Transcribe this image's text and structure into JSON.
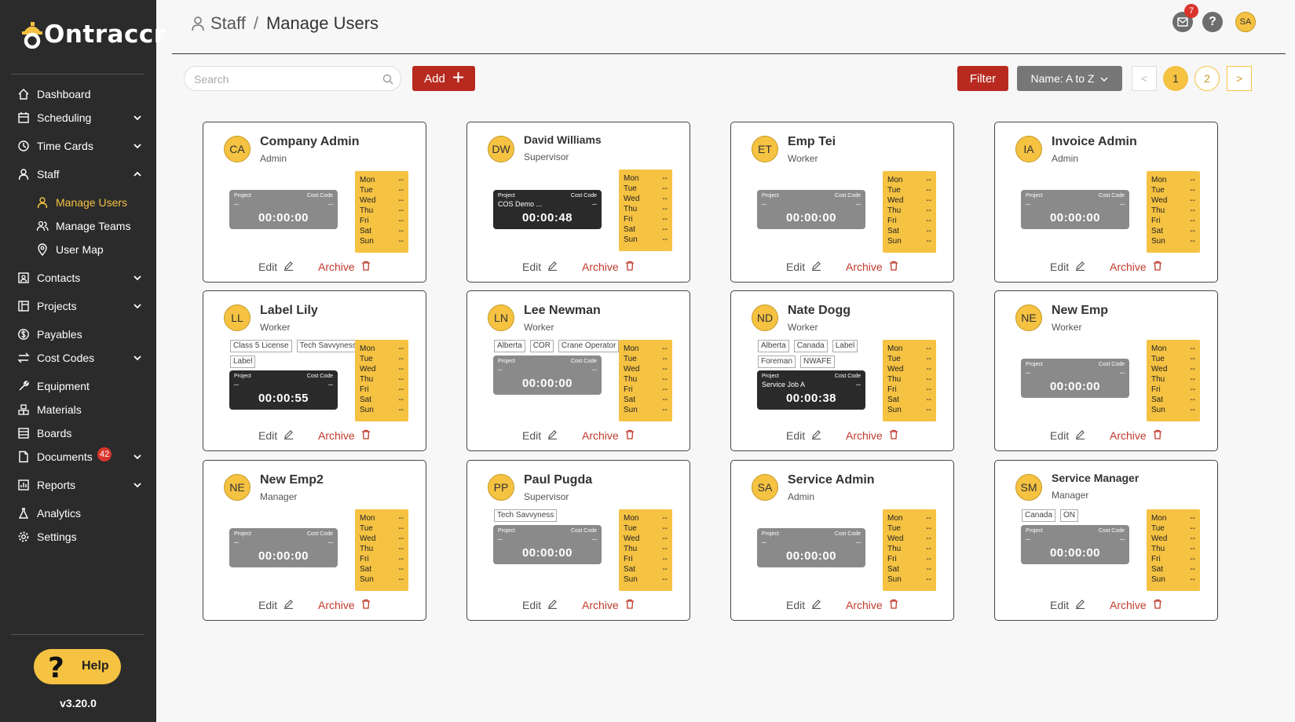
{
  "app": {
    "name": "Ontraccr",
    "version": "v3.20.0",
    "help_label": "Help"
  },
  "colors": {
    "accent": "#f5c242",
    "primary_action": "#b82a1f",
    "sidebar": "#2b2b2b"
  },
  "sidebar": {
    "items": [
      {
        "label": "Dashboard",
        "icon": "home-icon"
      },
      {
        "label": "Scheduling",
        "icon": "calendar-icon",
        "expandable": true
      },
      {
        "label": "Time Cards",
        "icon": "clock-icon",
        "expandable": true
      },
      {
        "label": "Staff",
        "icon": "person-icon",
        "expandable": true,
        "expanded": true
      },
      {
        "label": "Manage Users",
        "icon": "person-icon",
        "sub": true,
        "active": true
      },
      {
        "label": "Manage Teams",
        "icon": "team-icon",
        "sub": true
      },
      {
        "label": "User Map",
        "icon": "map-pin-icon",
        "sub": true
      },
      {
        "label": "Contacts",
        "icon": "contacts-icon",
        "expandable": true
      },
      {
        "label": "Projects",
        "icon": "projects-icon",
        "expandable": true
      },
      {
        "label": "Payables",
        "icon": "dollar-icon"
      },
      {
        "label": "Cost Codes",
        "icon": "swap-icon",
        "expandable": true
      },
      {
        "label": "Equipment",
        "icon": "wrench-icon"
      },
      {
        "label": "Materials",
        "icon": "materials-icon"
      },
      {
        "label": "Boards",
        "icon": "board-icon"
      },
      {
        "label": "Documents",
        "icon": "document-icon",
        "expandable": true,
        "badge": "42"
      },
      {
        "label": "Reports",
        "icon": "report-icon",
        "expandable": true
      },
      {
        "label": "Analytics",
        "icon": "flask-icon"
      },
      {
        "label": "Settings",
        "icon": "gear-icon"
      }
    ]
  },
  "header": {
    "breadcrumb_parent": "Staff",
    "breadcrumb_separator": "/",
    "breadcrumb_current": "Manage Users",
    "mail_badge": "7",
    "help_glyph": "?",
    "user_initials": "SA"
  },
  "toolbar": {
    "search_placeholder": "Search",
    "add_label": "Add",
    "filter_label": "Filter",
    "sort_label": "Name: A to Z",
    "pagination": {
      "prev": "<",
      "pages": [
        "1",
        "2"
      ],
      "current": "1",
      "next": ">"
    }
  },
  "labels": {
    "project": "Project",
    "cost_code": "Cost Code",
    "edit": "Edit",
    "archive": "Archive",
    "days": [
      "Mon",
      "Tue",
      "Wed",
      "Thu",
      "Fri",
      "Sat",
      "Sun"
    ],
    "day_value": "--"
  },
  "users": [
    {
      "initials": "CA",
      "name": "Company Admin",
      "role": "Admin",
      "tags": [],
      "project": "--",
      "cost_code": "--",
      "time": "00:00:00",
      "running": false
    },
    {
      "initials": "DW",
      "name": "David Williams",
      "role": "Supervisor",
      "tags": [],
      "project": "COS Demo ...",
      "cost_code": "--",
      "time": "00:00:48",
      "running": true
    },
    {
      "initials": "ET",
      "name": "Emp Tei",
      "role": "Worker",
      "tags": [],
      "project": "--",
      "cost_code": "--",
      "time": "00:00:00",
      "running": false
    },
    {
      "initials": "IA",
      "name": "Invoice Admin",
      "role": "Admin",
      "tags": [],
      "project": "--",
      "cost_code": "--",
      "time": "00:00:00",
      "running": false
    },
    {
      "initials": "LL",
      "name": "Label Lily",
      "role": "Worker",
      "tags": [
        "Class 5 License",
        "Tech Savvyness",
        "Label"
      ],
      "project": "--",
      "cost_code": "--",
      "time": "00:00:55",
      "running": true
    },
    {
      "initials": "LN",
      "name": "Lee Newman",
      "role": "Worker",
      "tags": [
        "Alberta",
        "COR",
        "Crane Operator"
      ],
      "project": "--",
      "cost_code": "--",
      "time": "00:00:00",
      "running": false
    },
    {
      "initials": "ND",
      "name": "Nate Dogg",
      "role": "Worker",
      "tags": [
        "Alberta",
        "Canada",
        "Label",
        "Foreman",
        "NWAFE"
      ],
      "project": "Service Job A",
      "cost_code": "--",
      "time": "00:00:38",
      "running": true
    },
    {
      "initials": "NE",
      "name": "New Emp",
      "role": "Worker",
      "tags": [],
      "project": "--",
      "cost_code": "--",
      "time": "00:00:00",
      "running": false
    },
    {
      "initials": "NE",
      "name": "New Emp2",
      "role": "Manager",
      "tags": [],
      "project": "--",
      "cost_code": "--",
      "time": "00:00:00",
      "running": false
    },
    {
      "initials": "PP",
      "name": "Paul Pugda",
      "role": "Supervisor",
      "tags": [
        "Tech Savvyness"
      ],
      "project": "--",
      "cost_code": "--",
      "time": "00:00:00",
      "running": false
    },
    {
      "initials": "SA",
      "name": "Service Admin",
      "role": "Admin",
      "tags": [],
      "project": "--",
      "cost_code": "--",
      "time": "00:00:00",
      "running": false
    },
    {
      "initials": "SM",
      "name": "Service Manager",
      "role": "Manager",
      "tags": [
        "Canada",
        "ON"
      ],
      "project": "--",
      "cost_code": "--",
      "time": "00:00:00",
      "running": false
    }
  ]
}
